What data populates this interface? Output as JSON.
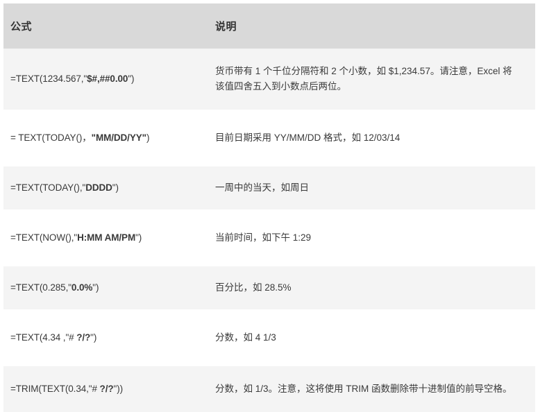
{
  "table": {
    "headers": {
      "formula": "公式",
      "description": "说明"
    },
    "rows": [
      {
        "formula_plain": "=TEXT(1234.567,\"",
        "formula_bold": "$#,##0.00",
        "formula_tail": "\")",
        "description": "货币带有 1 个千位分隔符和 2 个小数，如 $1,234.57。请注意，Excel 将该值四舍五入到小数点后两位。",
        "shaded": true
      },
      {
        "formula_plain": "= TEXT(TODAY()，",
        "formula_bold": "\"MM/DD/YY\"",
        "formula_tail": ")",
        "description": "目前日期采用 YY/MM/DD 格式，如 12/03/14",
        "shaded": false
      },
      {
        "formula_plain": "=TEXT(TODAY(),\"",
        "formula_bold": "DDDD",
        "formula_tail": "\")",
        "description": "一周中的当天，如周日",
        "shaded": true
      },
      {
        "formula_plain": "=TEXT(NOW(),\"",
        "formula_bold": "H:MM AM/PM",
        "formula_tail": "\")",
        "description": "当前时间，如下午 1:29",
        "shaded": false
      },
      {
        "formula_plain": "=TEXT(0.285,\"",
        "formula_bold": "0.0%",
        "formula_tail": "\")",
        "description": "百分比，如 28.5%",
        "shaded": true
      },
      {
        "formula_plain": "=TEXT(4.34 ,\"# ",
        "formula_bold": "?/?",
        "formula_tail": "\")",
        "description": "分数，如 4 1/3",
        "shaded": false
      },
      {
        "formula_plain": "=TRIM(TEXT(0.34,\"# ",
        "formula_bold": "?/?",
        "formula_tail": "\"))",
        "description": "分数，如 1/3。注意，这将使用 TRIM 函数删除带十进制值的前导空格。",
        "shaded": true
      }
    ]
  },
  "colors": {
    "header_background": "#d9d9d9",
    "shaded_row_background": "#f4f4f4",
    "plain_row_background": "#ffffff",
    "text": "#333333",
    "page_background": "#ffffff"
  }
}
